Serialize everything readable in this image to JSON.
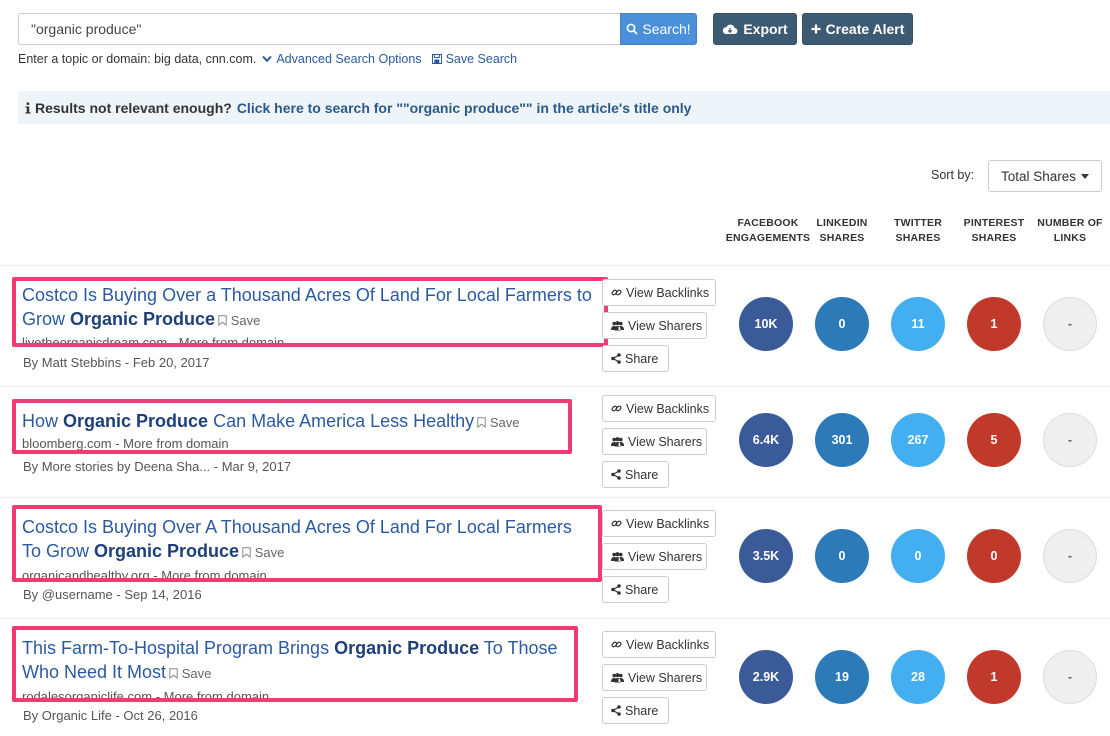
{
  "search": {
    "value": "\"organic produce\"",
    "button_label": "Search!",
    "export_label": "Export",
    "alert_label": "Create Alert"
  },
  "hint": {
    "text": "Enter a topic or domain: big data, cnn.com.",
    "advanced_label": "Advanced Search Options",
    "save_search_label": "Save Search"
  },
  "notice": {
    "lead": "Results not relevant enough?",
    "link": "Click here to search for \"\"organic produce\"\" in the article's title only"
  },
  "sort": {
    "label": "Sort by:",
    "value": "Total Shares"
  },
  "columns": [
    {
      "line1": "FACEBOOK",
      "line2": "ENGAGEMENTS"
    },
    {
      "line1": "LINKEDIN",
      "line2": "SHARES"
    },
    {
      "line1": "TWITTER",
      "line2": "SHARES"
    },
    {
      "line1": "PINTEREST",
      "line2": "SHARES"
    },
    {
      "line1": "NUMBER OF",
      "line2": "LINKS"
    }
  ],
  "actions": {
    "backlinks": "View Backlinks",
    "sharers": "View Sharers",
    "share": "Share"
  },
  "results": [
    {
      "title_a": "Costco Is Buying Over a Thousand Acres Of Land For Local Farmers to Grow ",
      "title_b": "Organic Produce",
      "title_c": "",
      "save": "Save",
      "domain": "livetheorganicdream.com",
      "more": "More from domain",
      "byline": "By Matt Stebbins - Feb 20, 2017",
      "facebook": "10K",
      "linkedin": "0",
      "twitter": "11",
      "pinterest": "1",
      "links": "-"
    },
    {
      "title_a": "How ",
      "title_b": "Organic Produce",
      "title_c": " Can Make America Less Healthy",
      "save": "Save",
      "domain": "bloomberg.com",
      "more": "More from domain",
      "byline": "By More stories by Deena Sha... - Mar 9, 2017",
      "facebook": "6.4K",
      "linkedin": "301",
      "twitter": "267",
      "pinterest": "5",
      "links": "-"
    },
    {
      "title_a": "Costco Is Buying Over A Thousand Acres Of Land For Local Farmers To Grow ",
      "title_b": "Organic Produce",
      "title_c": "",
      "save": "Save",
      "domain": "organicandhealthy.org",
      "more": "More from domain",
      "byline": "By @username - Sep 14, 2016",
      "facebook": "3.5K",
      "linkedin": "0",
      "twitter": "0",
      "pinterest": "0",
      "links": "-"
    },
    {
      "title_a": "This Farm-To-Hospital Program Brings ",
      "title_b": "Organic Produce",
      "title_c": " To Those Who Need It Most",
      "save": "Save",
      "domain": "rodalesorganiclife.com",
      "more": "More from domain",
      "byline": "By Organic Life - Oct 26, 2016",
      "facebook": "2.9K",
      "linkedin": "19",
      "twitter": "28",
      "pinterest": "1",
      "links": "-"
    }
  ]
}
